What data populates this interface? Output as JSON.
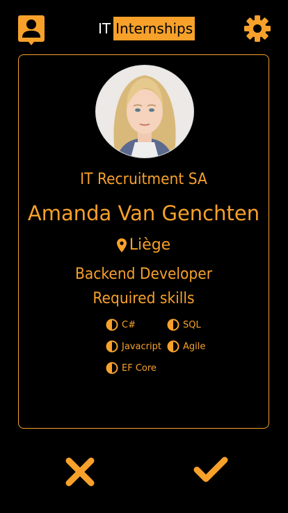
{
  "header": {
    "brand_prefix": "IT",
    "brand_name": "Internships",
    "profile_icon": "user-icon",
    "settings_icon": "gear-icon"
  },
  "card": {
    "company": "IT Recruitment SA",
    "name": "Amanda Van Genchten",
    "location": "Liège",
    "location_icon": "map-pin-icon",
    "role": "Backend Developer",
    "skills_title": "Required skills",
    "skills": [
      "C#",
      "SQL",
      "Javacript",
      "Agile",
      "EF Core"
    ],
    "skill_icon": "half-circle-icon"
  },
  "actions": {
    "reject_icon": "close-icon",
    "accept_icon": "check-icon"
  },
  "colors": {
    "accent": "#F7A12B",
    "background": "#000000"
  }
}
